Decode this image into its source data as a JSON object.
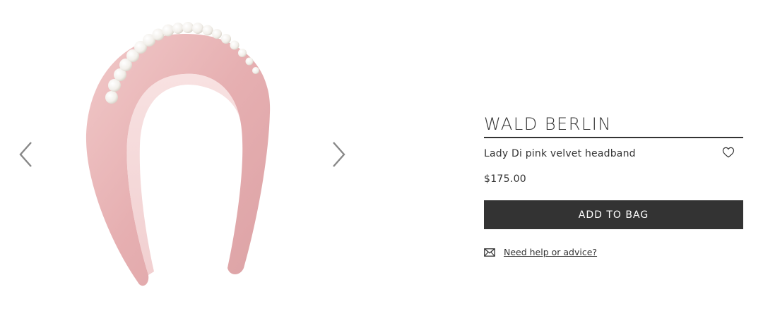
{
  "product": {
    "brand": "WALD BERLIN",
    "name": "Lady Di pink velvet headband",
    "price": "$175.00",
    "add_to_bag_label": "ADD TO BAG",
    "help_link_label": "Need help or advice?",
    "image_alt": "Lady Di pink velvet headband"
  },
  "gallery": {
    "prev_icon": "chevron-left-icon",
    "next_icon": "chevron-right-icon"
  },
  "icons": {
    "wishlist": "heart-outline-icon",
    "help": "envelope-icon"
  },
  "colors": {
    "text": "#333333",
    "button_bg": "#333333",
    "button_text": "#ffffff",
    "arrow": "#888888",
    "velvet": "#e9b7b8"
  }
}
